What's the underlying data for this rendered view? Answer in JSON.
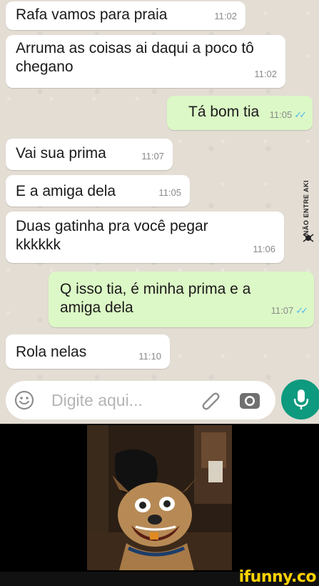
{
  "messages": [
    {
      "dir": "in",
      "text": "Rafa vamos para praia",
      "time": "11:02"
    },
    {
      "dir": "in",
      "text": "Arruma as coisas ai daqui a poco tô chegano",
      "time": "11:02"
    },
    {
      "dir": "out",
      "text": "Tá bom tia",
      "time": "11:05"
    },
    {
      "dir": "in",
      "text": "Vai sua prima",
      "time": "11:07"
    },
    {
      "dir": "in",
      "text": "E a amiga dela",
      "time": "11:05"
    },
    {
      "dir": "in",
      "text": "Duas gatinha pra você pegar kkkkkk",
      "time": "11:06"
    },
    {
      "dir": "out",
      "text": "Q isso tia, é minha prima e a amiga dela",
      "time": "11:07"
    },
    {
      "dir": "in",
      "text": "Rola nelas",
      "time": "11:10"
    }
  ],
  "input": {
    "placeholder": "Digite aqui..."
  },
  "watermark": {
    "text": "NÃO ENTRE AKI"
  },
  "brand": {
    "text": "ifunny.co"
  },
  "colors": {
    "incoming": "#ffffff",
    "outgoing": "#dcf8c6",
    "mic": "#0e9a7e",
    "ticks": "#4fb6ec",
    "brand": "#ffd200"
  },
  "icons": [
    "emoji-icon",
    "paperclip-icon",
    "camera-icon",
    "mic-icon",
    "double-check-icon"
  ]
}
